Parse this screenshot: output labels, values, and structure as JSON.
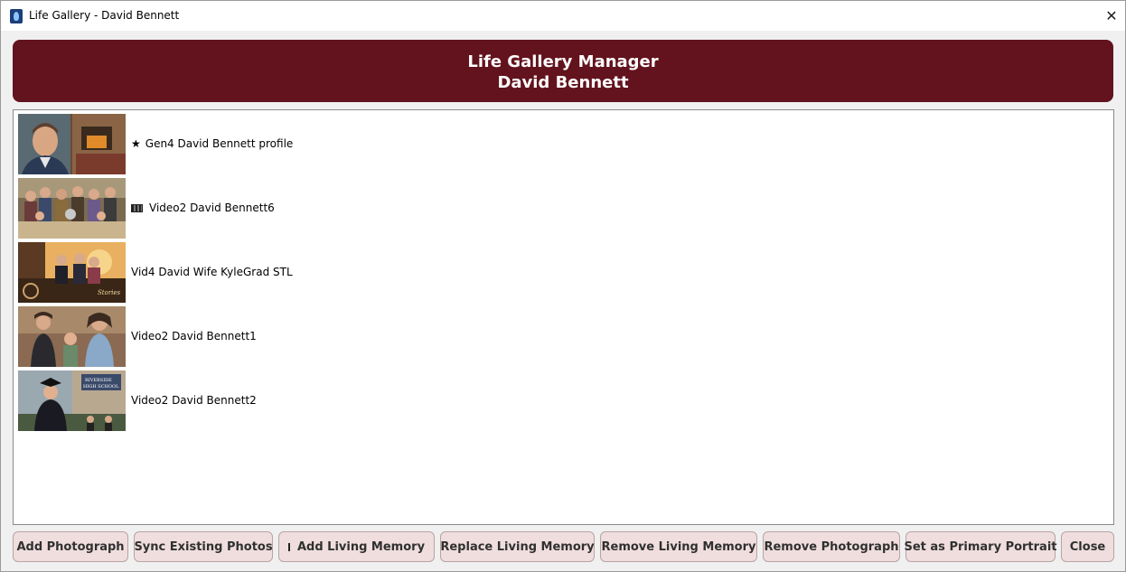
{
  "window": {
    "title": "Life Gallery - David Bennett",
    "icon": "app-icon",
    "close_glyph": "✕"
  },
  "header": {
    "line1": "Life Gallery Manager",
    "line2": "David Bennett",
    "color": "#63131d"
  },
  "gallery": {
    "items": [
      {
        "label": "Gen4 David Bennett profile",
        "marker": "★",
        "marker_name": "star-icon"
      },
      {
        "label": "Video2 David Bennett6",
        "marker": "",
        "marker_name": "film-icon"
      },
      {
        "label": "Vid4 David Wife KyleGrad STL",
        "marker": "",
        "marker_name": ""
      },
      {
        "label": "Video2 David Bennett1",
        "marker": "",
        "marker_name": ""
      },
      {
        "label": "Video2 David Bennett2",
        "marker": "",
        "marker_name": ""
      }
    ]
  },
  "footer": {
    "add_photo": "Add Photograph",
    "sync": "Sync Existing Photos",
    "add_memory": "Add Living Memory",
    "replace_memory": "Replace Living Memory",
    "remove_memory": "Remove Living Memory",
    "remove_photo": "Remove Photograph",
    "set_primary": "Set as Primary Portrait",
    "close": "Close"
  },
  "colors": {
    "button_bg": "#f0dede",
    "button_text": "#303030"
  }
}
